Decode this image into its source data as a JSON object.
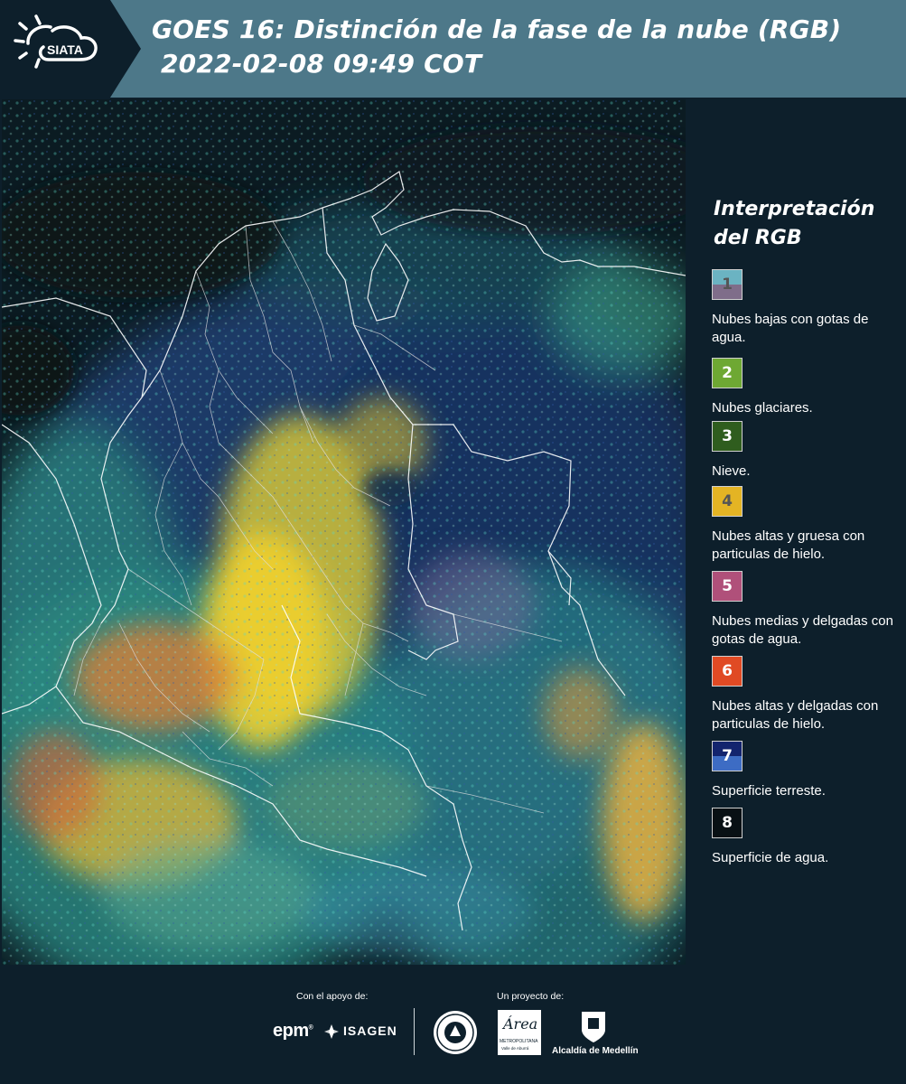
{
  "header": {
    "logo_text": "SIATA",
    "title_line1": "GOES 16: Distinción de la fase de la nube (RGB)",
    "title_line2": "2022-02-08 09:49 COT"
  },
  "legend": {
    "title_line1": "Interpretación",
    "title_line2": "del RGB",
    "items": [
      {
        "number": "1",
        "label": "Nubes bajas con gotas de agua.",
        "color_top": "#6bb3c2",
        "color_bottom": "#7f6d8a",
        "text_color": "#555555"
      },
      {
        "number": "2",
        "label": "Nubes glaciares.",
        "color_top": "#6ea833",
        "color_bottom": "#6ea833",
        "text_color": "#ffffff"
      },
      {
        "number": "3",
        "label": "Nieve.",
        "color_top": "#2f5d1e",
        "color_bottom": "#2f5d1e",
        "text_color": "#ffffff"
      },
      {
        "number": "4",
        "label": "Nubes altas y gruesa con particulas de hielo.",
        "color_top": "#e4b424",
        "color_bottom": "#e4b424",
        "text_color": "#555555"
      },
      {
        "number": "5",
        "label": "Nubes medias y delgadas con gotas de agua.",
        "color_top": "#b0507a",
        "color_bottom": "#b0507a",
        "text_color": "#ffffff"
      },
      {
        "number": "6",
        "label": "Nubes altas y delgadas con particulas de hielo.",
        "color_top": "#e04a24",
        "color_bottom": "#e04a24",
        "text_color": "#ffffff"
      },
      {
        "number": "7",
        "label": "Superficie terreste.",
        "color_top": "#13246e",
        "color_bottom": "#3d6cc4",
        "text_color": "#ffffff"
      },
      {
        "number": "8",
        "label": "Superficie de agua.",
        "color_top": "#081014",
        "color_bottom": "#081014",
        "text_color": "#ffffff"
      }
    ]
  },
  "footer": {
    "support_label": "Con el apoyo de:",
    "project_label": "Un proyecto de:",
    "epm_text": "epm",
    "isagen_text": "ISAGEN",
    "metropolitana_text": "Área",
    "metropolitana_sub": "METROPOLITANA",
    "metropolitana_sub2": "Valle de Aburrá",
    "alcaldia_text": "Alcaldía de Medellín"
  }
}
